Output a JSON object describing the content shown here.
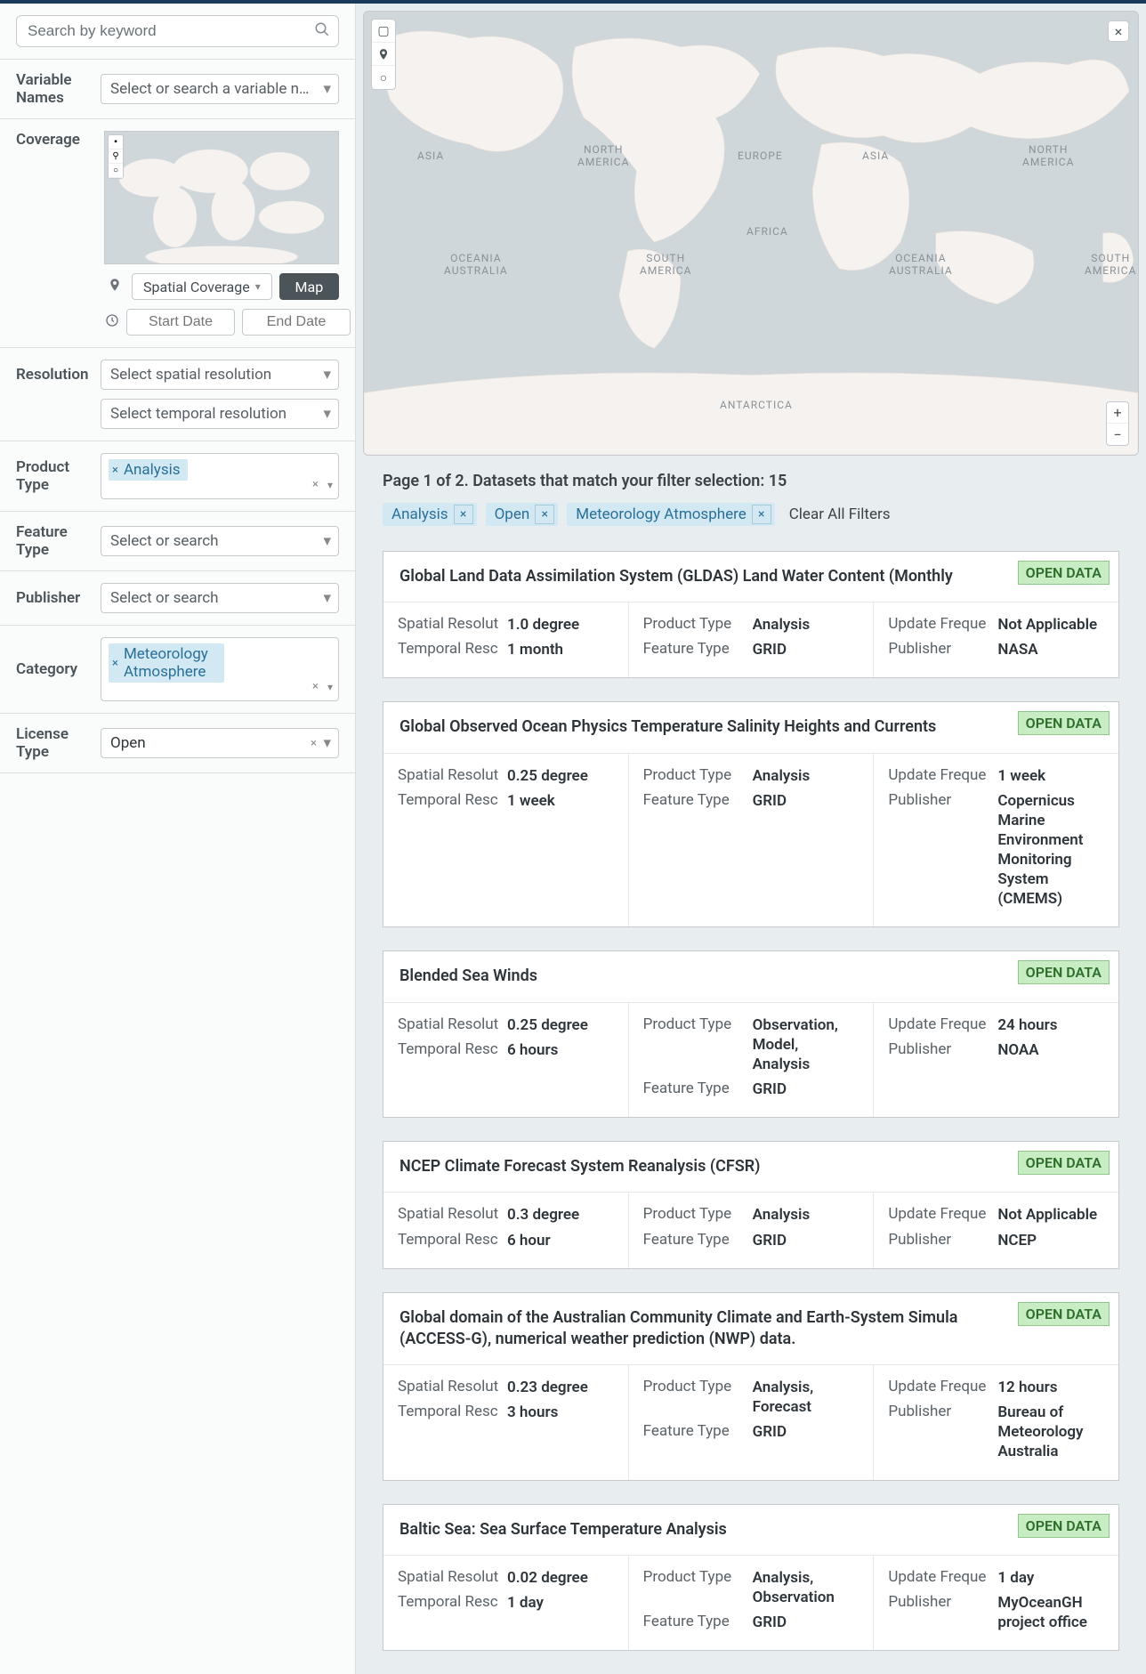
{
  "search": {
    "placeholder": "Search by keyword"
  },
  "sidebar": {
    "variable_names": {
      "label": "Variable Names",
      "placeholder": "Select or search a variable n…"
    },
    "coverage": {
      "label": "Coverage",
      "spatial_btn": "Spatial Coverage",
      "map_btn": "Map",
      "start_placeholder": "Start Date",
      "end_placeholder": "End Date"
    },
    "resolution": {
      "label": "Resolution",
      "spatial_placeholder": "Select spatial resolution",
      "temporal_placeholder": "Select temporal resolution"
    },
    "product_type": {
      "label": "Product Type",
      "tag": "Analysis"
    },
    "feature_type": {
      "label": "Feature Type",
      "placeholder": "Select or search"
    },
    "publisher": {
      "label": "Publisher",
      "placeholder": "Select or search"
    },
    "category": {
      "label": "Category",
      "tag": "Meteorology Atmosphere"
    },
    "license": {
      "label": "License Type",
      "value": "Open"
    }
  },
  "map_labels": {
    "asia1": "ASIA",
    "north_america1": "NORTH\nAMERICA",
    "europe": "EUROPE",
    "asia2": "ASIA",
    "north_america2": "NORTH\nAMERICA",
    "oceania1": "OCEANIA\nAUSTRALIA",
    "south_america1": "SOUTH\nAMERICA",
    "africa": "AFRICA",
    "oceania2": "OCEANIA\nAUSTRALIA",
    "south_america2": "SOUTH\nAMERICA",
    "antarctica": "ANTARCTICA"
  },
  "results": {
    "header": "Page 1 of 2. Datasets that match your filter selection: 15",
    "chips": [
      "Analysis",
      "Open",
      "Meteorology Atmosphere"
    ],
    "clear": "Clear All Filters",
    "field_labels": {
      "spatial": "Spatial Resolut",
      "temporal": "Temporal Resc",
      "product": "Product Type",
      "feature": "Feature Type",
      "update": "Update Freque",
      "publisher": "Publisher"
    },
    "open_badge": "OPEN DATA",
    "items": [
      {
        "title": "Global Land Data Assimilation System (GLDAS) Land Water Content (Monthly",
        "spatial": "1.0 degree",
        "temporal": "1 month",
        "product": "Analysis",
        "feature": "GRID",
        "update": "Not Applicable",
        "publisher": "NASA"
      },
      {
        "title": "Global Observed Ocean Physics Temperature Salinity Heights and Currents",
        "spatial": "0.25 degree",
        "temporal": "1 week",
        "product": "Analysis",
        "feature": "GRID",
        "update": "1 week",
        "publisher": "Copernicus Marine Environment Monitoring System (CMEMS)"
      },
      {
        "title": "Blended Sea Winds",
        "spatial": "0.25 degree",
        "temporal": "6 hours",
        "product": "Observation, Model, Analysis",
        "feature": "GRID",
        "update": "24 hours",
        "publisher": "NOAA"
      },
      {
        "title": "NCEP Climate Forecast System Reanalysis (CFSR)",
        "spatial": "0.3 degree",
        "temporal": "6 hour",
        "product": "Analysis",
        "feature": "GRID",
        "update": "Not Applicable",
        "publisher": "NCEP"
      },
      {
        "title": "Global domain of the Australian Community Climate and Earth-System Simula (ACCESS-G), numerical weather prediction (NWP) data.",
        "spatial": "0.23 degree",
        "temporal": "3 hours",
        "product": "Analysis, Forecast",
        "feature": "GRID",
        "update": "12 hours",
        "publisher": "Bureau of Meteorology Australia"
      },
      {
        "title": "Baltic Sea: Sea Surface Temperature Analysis",
        "spatial": "0.02 degree",
        "temporal": "1 day",
        "product": "Analysis, Observation",
        "feature": "GRID",
        "update": "1 day",
        "publisher": "MyOceanGH project office"
      }
    ]
  }
}
